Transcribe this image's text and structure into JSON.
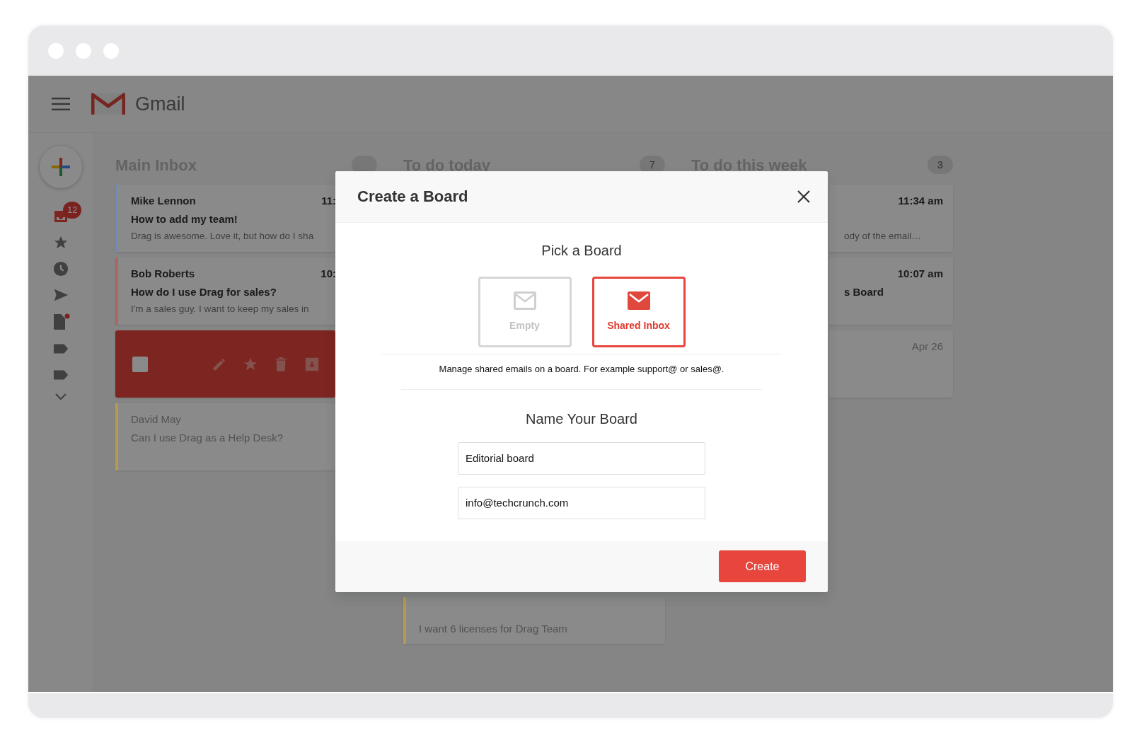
{
  "app": {
    "name": "Gmail"
  },
  "sidebar": {
    "inbox_badge": "12"
  },
  "columns": [
    {
      "title": "Main Inbox",
      "cards": [
        {
          "kind": "email",
          "sender": "Mike Lennon",
          "time": "11:",
          "subject": "How to add my team!",
          "snippet": "Drag is awesome. Love it, but how do I sha",
          "color": "#7389b8",
          "unread": true
        },
        {
          "kind": "email",
          "sender": "Bob Roberts",
          "time": "10:",
          "subject": "How do I use Drag for sales?",
          "snippet": "I'm a sales guy. I want to keep my sales in",
          "color": "#b0655f",
          "unread": true
        },
        {
          "kind": "hover",
          "checked": false
        },
        {
          "kind": "email",
          "sender": "David May",
          "subject": "Can I use Drag as a Help Desk?",
          "color": "#b59a4f",
          "unread": false
        }
      ]
    },
    {
      "title": "To do today",
      "count": "7",
      "cards": [
        {
          "kind": "email",
          "subject": "I want 6 licenses for Drag Team",
          "color": "#b59a4f",
          "unread": false
        }
      ]
    },
    {
      "title": "To do this week",
      "count": "3",
      "cards": [
        {
          "kind": "email",
          "time": "11:34 am",
          "snippet": "ody of the email…",
          "unread": true
        },
        {
          "kind": "email",
          "time": "10:07 am",
          "subject": "s Board",
          "unread": true
        },
        {
          "kind": "email",
          "time": "Apr 26",
          "unread": false
        }
      ]
    }
  ],
  "dialog": {
    "title": "Create a Board",
    "pick_heading": "Pick a Board",
    "options": [
      {
        "label": "Empty",
        "selected": false
      },
      {
        "label": "Shared Inbox",
        "selected": true
      }
    ],
    "description": "Manage shared emails on a board. For example support@ or sales@.",
    "name_heading": "Name Your Board",
    "fields": [
      {
        "value": "Editorial board"
      },
      {
        "value": "info@techcrunch.com"
      }
    ],
    "submit": "Create"
  }
}
